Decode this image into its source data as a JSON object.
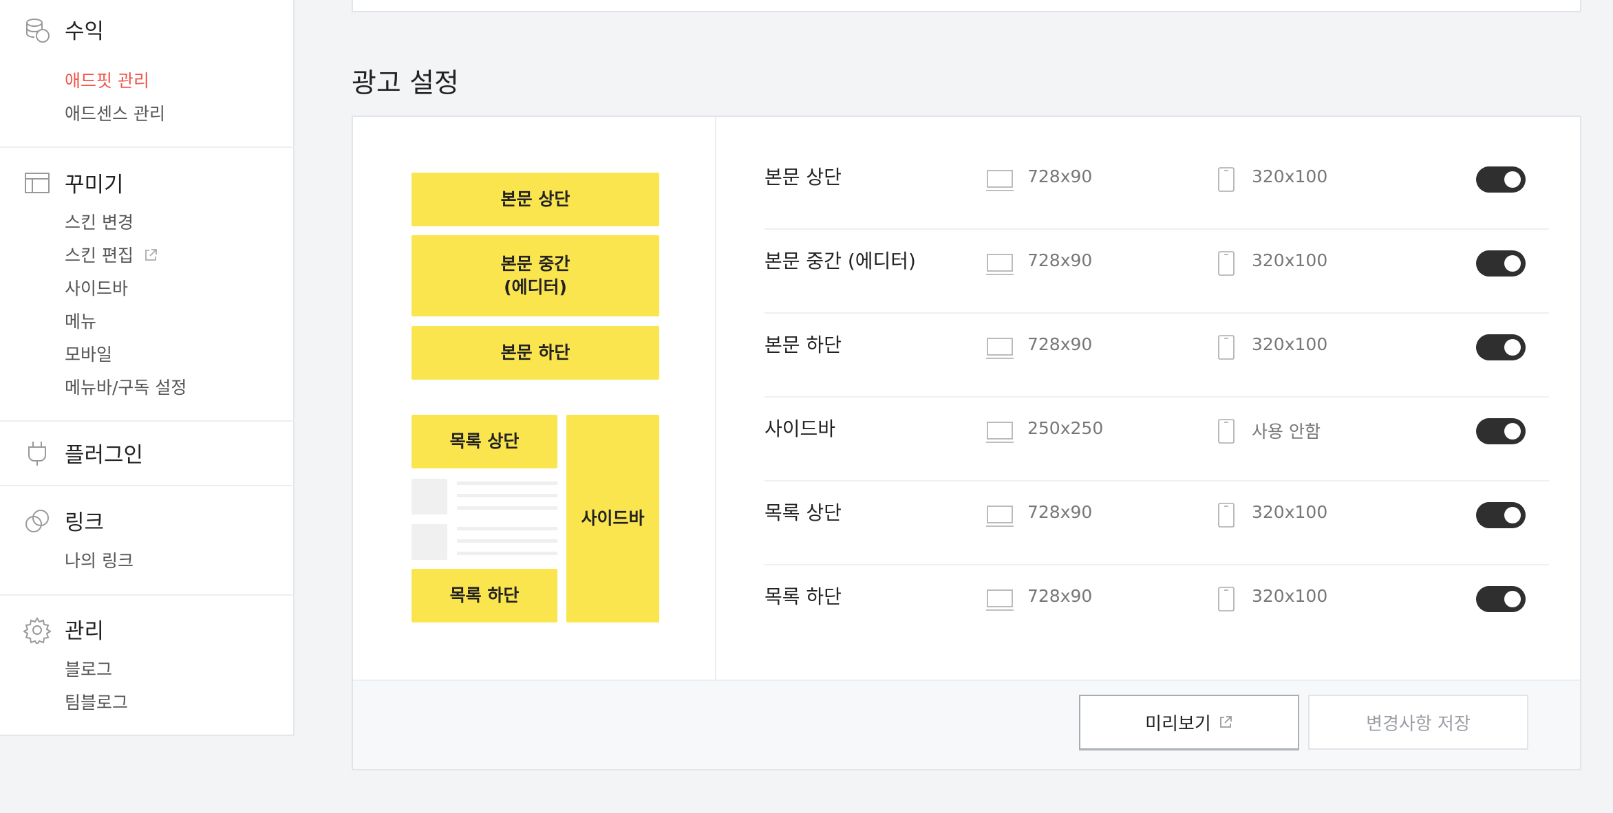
{
  "sidebar": {
    "revenue": {
      "title": "수익",
      "items": [
        "애드핏 관리",
        "애드센스 관리"
      ],
      "active_index": 0
    },
    "decorate": {
      "title": "꾸미기",
      "items": [
        "스킨 변경",
        "스킨 편집",
        "사이드바",
        "메뉴",
        "모바일",
        "메뉴바/구독 설정"
      ]
    },
    "plugin": {
      "title": "플러그인"
    },
    "link": {
      "title": "링크",
      "items": [
        "나의 링크"
      ]
    },
    "manage": {
      "title": "관리",
      "items": [
        "블로그",
        "팀블로그"
      ]
    },
    "icons": [
      "coins-icon",
      "layout-icon",
      "plug-icon",
      "link-icon",
      "gear-icon",
      "external-link-icon"
    ]
  },
  "main": {
    "title": "광고 설정",
    "diagram": {
      "body_top": "본문 상단",
      "body_middle_line1": "본문 중간",
      "body_middle_line2": "(에디터)",
      "body_bottom": "본문 하단",
      "list_top": "목록 상단",
      "list_bottom": "목록 하단",
      "sidebar": "사이드바"
    },
    "rows": [
      {
        "label": "본문 상단",
        "pc": "728x90",
        "mobile": "320x100",
        "enabled": true
      },
      {
        "label": "본문 중간 (에디터)",
        "pc": "728x90",
        "mobile": "320x100",
        "enabled": true
      },
      {
        "label": "본문 하단",
        "pc": "728x90",
        "mobile": "320x100",
        "enabled": true
      },
      {
        "label": "사이드바",
        "pc": "250x250",
        "mobile": "사용 안함",
        "enabled": true
      },
      {
        "label": "목록 상단",
        "pc": "728x90",
        "mobile": "320x100",
        "enabled": true
      },
      {
        "label": "목록 하단",
        "pc": "728x90",
        "mobile": "320x100",
        "enabled": true
      }
    ],
    "buttons": {
      "preview": "미리보기",
      "save": "변경사항 저장"
    }
  },
  "colors": {
    "accent_active": "#f0564a",
    "ad_yellow": "#fbe54e",
    "toggle_on": "#2f2f2f"
  }
}
